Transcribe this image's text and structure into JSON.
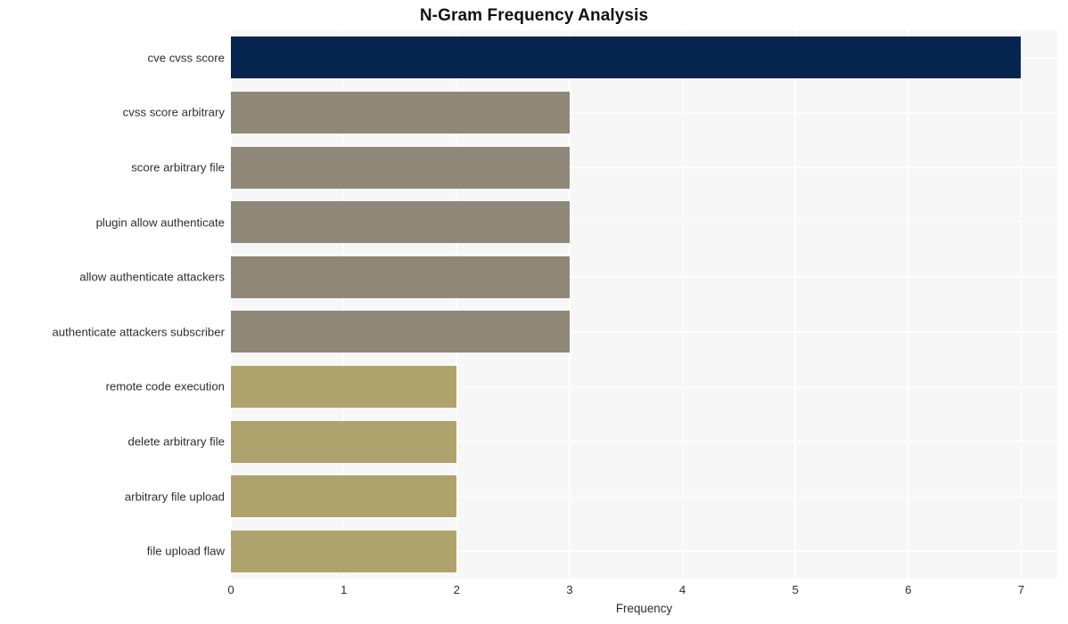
{
  "chart_data": {
    "type": "bar",
    "orientation": "horizontal",
    "title": "N-Gram Frequency Analysis",
    "xlabel": "Frequency",
    "ylabel": "",
    "categories": [
      "cve cvss score",
      "cvss score arbitrary",
      "score arbitrary file",
      "plugin allow authenticate",
      "allow authenticate attackers",
      "authenticate attackers subscriber",
      "remote code execution",
      "delete arbitrary file",
      "arbitrary file upload",
      "file upload flaw"
    ],
    "values": [
      7,
      3,
      3,
      3,
      3,
      3,
      2,
      2,
      2,
      2
    ],
    "bar_colors": [
      "#06254f",
      "#8f8878",
      "#8f8878",
      "#8f8878",
      "#8f8878",
      "#8f8878",
      "#afa36d",
      "#afa36d",
      "#afa36d",
      "#afa36d"
    ],
    "xlim": [
      0,
      7.32
    ],
    "xticks": [
      0,
      1,
      2,
      3,
      4,
      5,
      6,
      7
    ],
    "xtick_labels": [
      "0",
      "1",
      "2",
      "3",
      "4",
      "5",
      "6",
      "7"
    ],
    "grid": true,
    "grid_color": "#ffffff",
    "plot_background": "#f7f7f7",
    "figure_background": "#ffffff",
    "legend": null
  }
}
